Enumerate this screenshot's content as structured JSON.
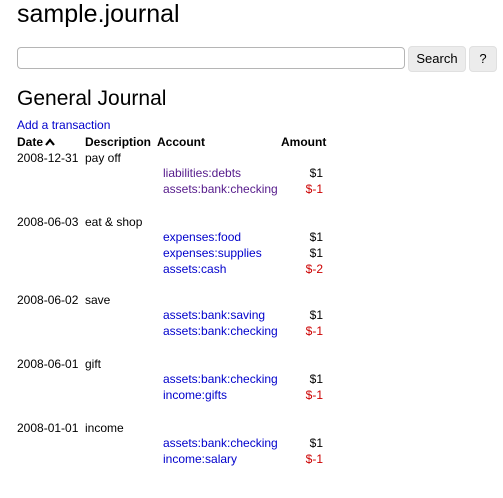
{
  "app": {
    "title": "sample.journal"
  },
  "search": {
    "value": "",
    "placeholder": "",
    "button_label": "Search",
    "help_label": "?"
  },
  "page": {
    "heading": "General Journal",
    "add_transaction_label": "Add a transaction"
  },
  "journal": {
    "columns": {
      "date": "Date",
      "date_sort_icon": "caret-up-icon",
      "description": "Description",
      "account": "Account",
      "amount": "Amount"
    },
    "transactions": [
      {
        "date": "2008-12-31",
        "description": "pay off",
        "postings": [
          {
            "account": "liabilities:debts",
            "amount": "$1",
            "negative": false,
            "visited": true
          },
          {
            "account": "assets:bank:checking",
            "amount": "$-1",
            "negative": true,
            "visited": true
          }
        ]
      },
      {
        "date": "2008-06-03",
        "description": "eat & shop",
        "postings": [
          {
            "account": "expenses:food",
            "amount": "$1",
            "negative": false,
            "visited": false
          },
          {
            "account": "expenses:supplies",
            "amount": "$1",
            "negative": false,
            "visited": false
          },
          {
            "account": "assets:cash",
            "amount": "$-2",
            "negative": true,
            "visited": false
          }
        ]
      },
      {
        "date": "2008-06-02",
        "description": "save",
        "postings": [
          {
            "account": "assets:bank:saving",
            "amount": "$1",
            "negative": false,
            "visited": false
          },
          {
            "account": "assets:bank:checking",
            "amount": "$-1",
            "negative": true,
            "visited": false
          }
        ]
      },
      {
        "date": "2008-06-01",
        "description": "gift",
        "postings": [
          {
            "account": "assets:bank:checking",
            "amount": "$1",
            "negative": false,
            "visited": false
          },
          {
            "account": "income:gifts",
            "amount": "$-1",
            "negative": true,
            "visited": false
          }
        ]
      },
      {
        "date": "2008-01-01",
        "description": "income",
        "postings": [
          {
            "account": "assets:bank:checking",
            "amount": "$1",
            "negative": false,
            "visited": false
          },
          {
            "account": "income:salary",
            "amount": "$-1",
            "negative": true,
            "visited": false
          }
        ]
      }
    ]
  },
  "colors": {
    "link": "#0000cc",
    "visited_link": "#551a8b",
    "negative_amount": "#cc0000"
  }
}
